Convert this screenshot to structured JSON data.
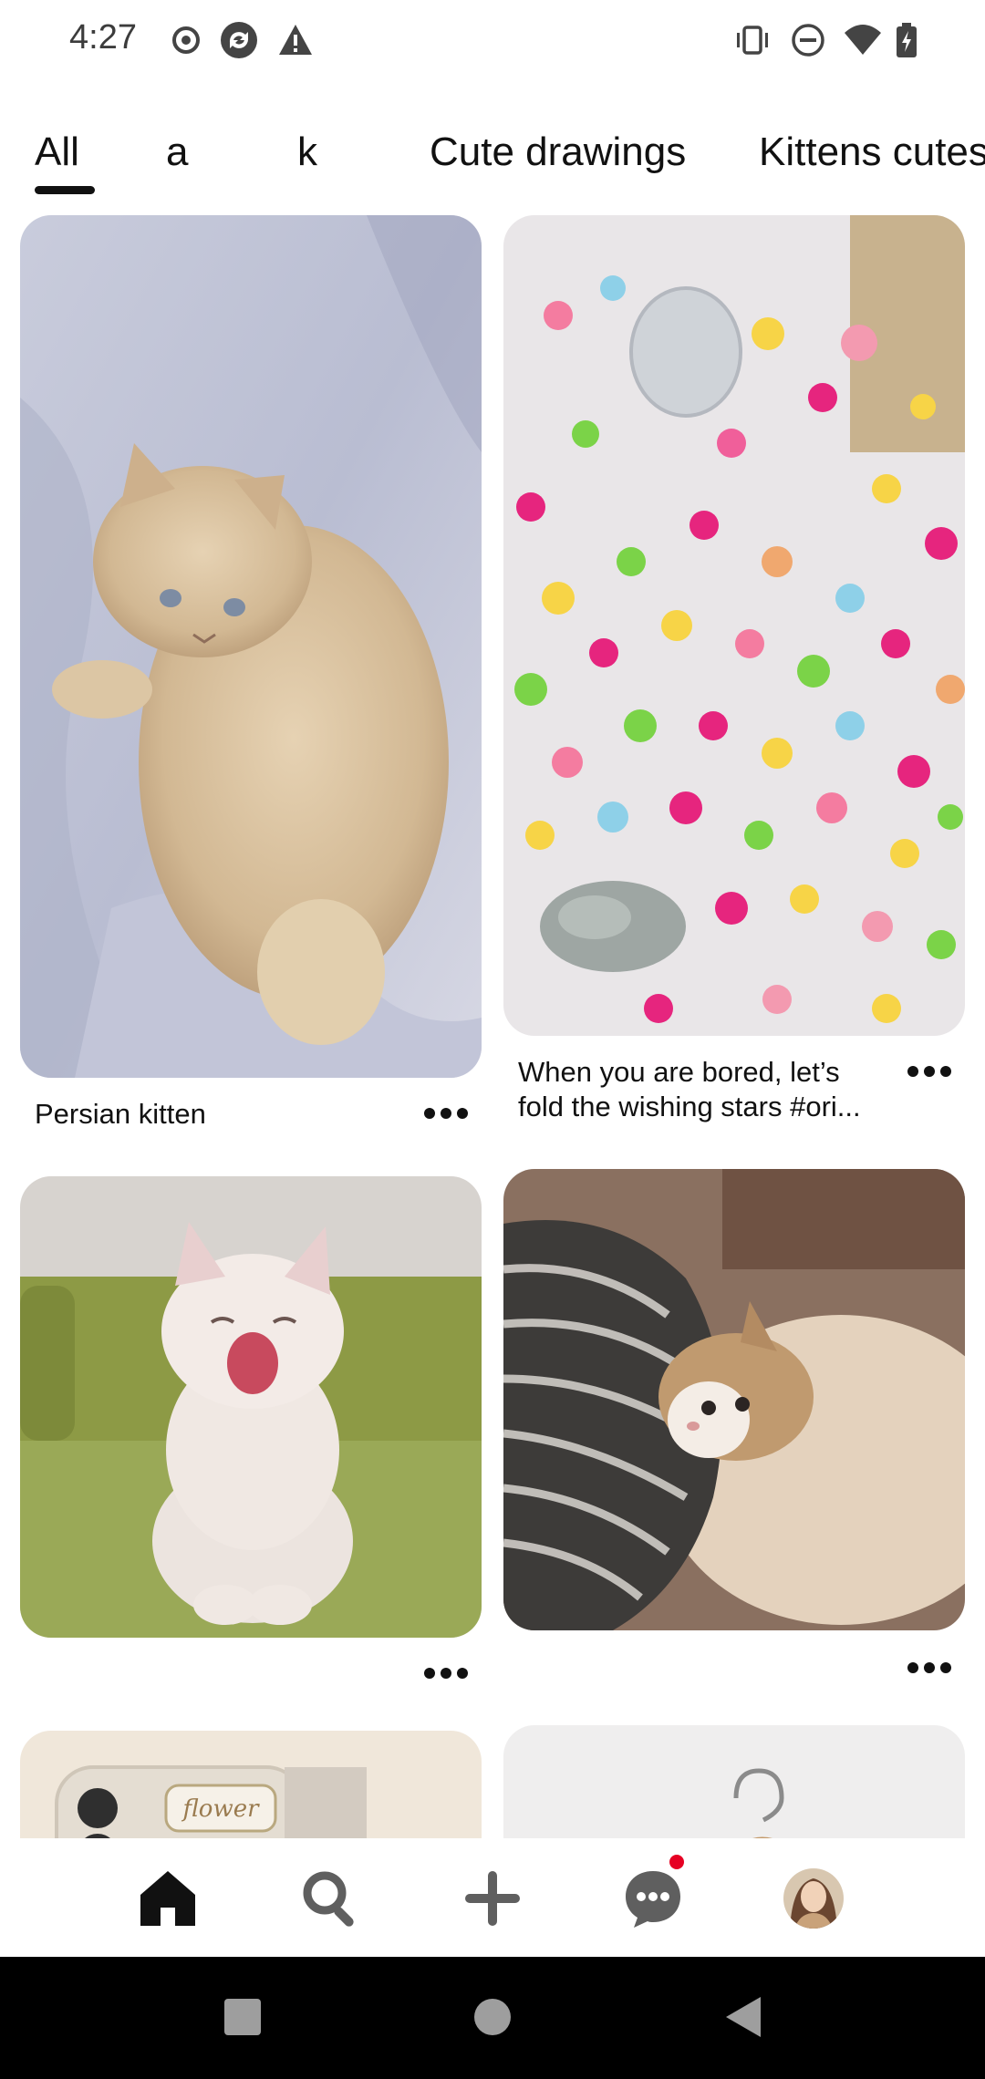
{
  "status_bar": {
    "time": "4:27",
    "left_icons": [
      "record-icon",
      "sync-icon",
      "warning-icon"
    ],
    "right_icons": [
      "vibrate-icon",
      "do-not-disturb-icon",
      "wifi-icon",
      "battery-charging-icon"
    ]
  },
  "tabs": [
    {
      "label": "All",
      "active": true
    },
    {
      "label": "a",
      "active": false
    },
    {
      "label": "k",
      "active": false
    },
    {
      "label": "Cute drawings",
      "active": false
    },
    {
      "label": "Kittens cutest",
      "active": false
    }
  ],
  "feed": {
    "pins": [
      {
        "image": "persian-kitten-on-blanket",
        "title": "Persian kitten"
      },
      {
        "image": "colorful-origami-stars",
        "title_line1": "When you are bored, let’s",
        "title_line2": "fold the wishing stars #ori..."
      },
      {
        "image": "yawning-kitten-on-sofa",
        "title": ""
      },
      {
        "image": "kitten-under-blanket",
        "title": ""
      },
      {
        "image": "phone-case-flower",
        "title": ""
      },
      {
        "image": "hanger-on-wall",
        "title": ""
      }
    ]
  },
  "bottom_nav": {
    "items": [
      "home-icon",
      "search-icon",
      "create-icon",
      "messages-icon",
      "profile-avatar"
    ],
    "active": "home-icon",
    "notification_color": "#e60023"
  },
  "system_nav": [
    "recents-icon",
    "home-circle-icon",
    "back-icon"
  ],
  "colors": {
    "text": "#111111",
    "accent": "#e60023",
    "background": "#ffffff"
  }
}
